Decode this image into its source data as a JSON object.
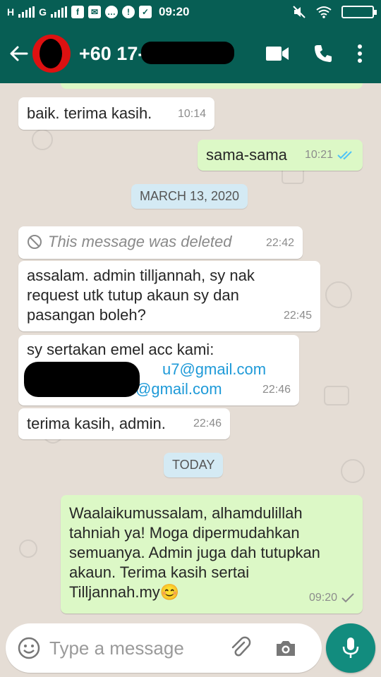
{
  "status_bar": {
    "network_1": "H",
    "network_2": "G",
    "time": "09:20"
  },
  "header": {
    "contact_visible": "+60 17-",
    "icons": [
      "back-arrow-icon",
      "video-call-icon",
      "phone-icon",
      "more-vert-icon"
    ]
  },
  "chat": {
    "messages": [
      {
        "dir": "in",
        "text": "baik. terima kasih.",
        "time": "10:14"
      },
      {
        "dir": "out",
        "text": "sama-sama",
        "time": "10:21",
        "status": "read"
      },
      {
        "type": "date",
        "text": "MARCH 13, 2020"
      },
      {
        "dir": "in",
        "deleted": true,
        "text": "This message was deleted",
        "time": "22:42"
      },
      {
        "dir": "in",
        "lines": [
          "assalam. admin tilljannah, sy nak",
          "request utk tutup akaun sy dan",
          "pasangan boleh?"
        ],
        "time": "22:45"
      },
      {
        "dir": "in",
        "lines": [
          "sy sertakan emel acc kami:"
        ],
        "links": [
          "u7@gmail.com",
          "@gmail.com"
        ],
        "time": "22:46"
      },
      {
        "dir": "in",
        "text": "terima kasih, admin.",
        "time": "22:46"
      },
      {
        "type": "date",
        "text": "TODAY"
      },
      {
        "dir": "out",
        "lines": [
          "Waalaikumussalam, alhamdulillah",
          "tahniah ya! Moga dipermudahkan",
          "semuanya. Admin juga dah tutupkan",
          "akaun. Terima kasih sertai",
          "Tilljannah.my"
        ],
        "emoji": "😊",
        "time": "09:20",
        "status": "sent"
      }
    ]
  },
  "input": {
    "placeholder": "Type a message"
  },
  "colors": {
    "header": "#075e54",
    "incoming": "#ffffff",
    "outgoing": "#dcf8c6",
    "read_ticks": "#4fc3f7",
    "mic": "#128c7e"
  }
}
